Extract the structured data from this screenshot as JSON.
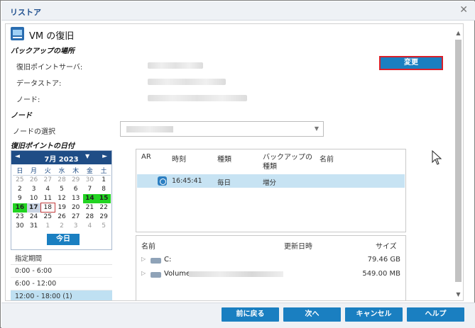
{
  "window": {
    "title": "リストア",
    "close_icon": "close-icon"
  },
  "page": {
    "heading": "VM の復旧"
  },
  "backup_location": {
    "section_title": "バックアップの場所",
    "recovery_point_server_label": "復旧ポイントサーバ:",
    "datastore_label": "データストア:",
    "node_label": "ノード:",
    "change_button": "変更"
  },
  "node": {
    "section_title": "ノード",
    "select_label": "ノードの選択"
  },
  "recovery_date": {
    "section_title": "復旧ポイントの日付"
  },
  "calendar": {
    "month_label": "7月 2023",
    "prev_label": "◄",
    "next_label": "►",
    "dropdown_label": "▼",
    "weekdays": [
      "日",
      "月",
      "火",
      "水",
      "木",
      "金",
      "土"
    ],
    "weeks": [
      [
        "25",
        "26",
        "27",
        "28",
        "29",
        "30",
        "1"
      ],
      [
        "2",
        "3",
        "4",
        "5",
        "6",
        "7",
        "8"
      ],
      [
        "9",
        "10",
        "11",
        "12",
        "13",
        "14",
        "15"
      ],
      [
        "16",
        "17",
        "18",
        "19",
        "20",
        "21",
        "22"
      ],
      [
        "23",
        "24",
        "25",
        "26",
        "27",
        "28",
        "29"
      ],
      [
        "30",
        "31",
        "1",
        "2",
        "3",
        "4",
        "5"
      ]
    ],
    "today_button": "今日"
  },
  "time_period": {
    "header": "指定期間",
    "items": [
      "0:00 - 6:00",
      "6:00 - 12:00",
      "12:00 - 18:00   (1)"
    ]
  },
  "recovery_points_table": {
    "columns": {
      "ar": "AR",
      "time": "時刻",
      "type": "種類",
      "backup_type": "バックアップの\n種類",
      "name": "名前"
    },
    "rows": [
      {
        "time": "16:45:41",
        "type": "毎日",
        "backup_type": "増分",
        "name": ""
      }
    ]
  },
  "files_table": {
    "columns": {
      "name": "名前",
      "modified": "更新日時",
      "size": "サイズ"
    },
    "rows": [
      {
        "name": "C:",
        "size": "79.46 GB"
      },
      {
        "name": "Volume",
        "size": "549.00 MB"
      }
    ]
  },
  "footer": {
    "back_button": "前に戻る",
    "next_button": "次へ",
    "cancel_button": "キャンセル",
    "help_button": "ヘルプ"
  },
  "colors": {
    "accent_blue": "#1a7fc1",
    "calendar_header": "#1f4d86",
    "available_day": "#22d422",
    "highlight_border": "#d9202a",
    "selected_row": "#c7e3f3"
  }
}
